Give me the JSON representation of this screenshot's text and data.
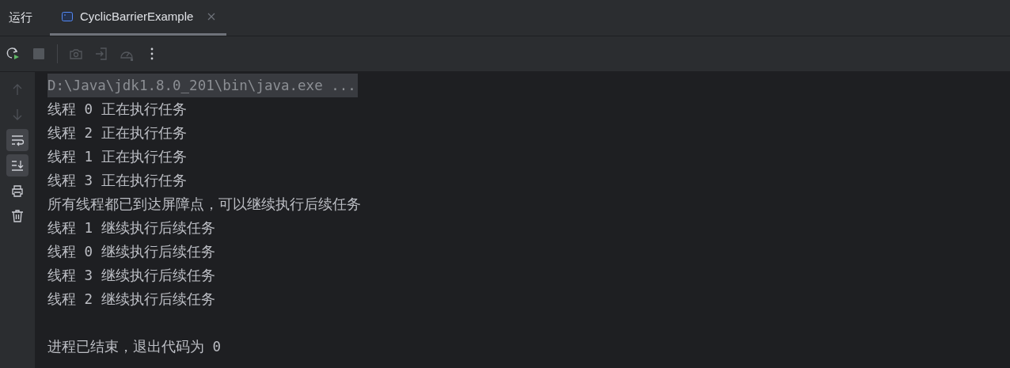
{
  "tool_window": {
    "title": "运行"
  },
  "tabs": [
    {
      "label": "CyclicBarrierExample",
      "selected": true
    }
  ],
  "toolbar": [
    {
      "kind": "rerun",
      "disabled": false
    },
    {
      "kind": "stop",
      "disabled": true
    },
    {
      "kind": "separator"
    },
    {
      "kind": "camera",
      "disabled": true
    },
    {
      "kind": "exit",
      "disabled": true
    },
    {
      "kind": "gauge",
      "disabled": true
    },
    {
      "kind": "more",
      "disabled": false
    }
  ],
  "gutter": [
    {
      "kind": "up",
      "on": false,
      "disabled": true
    },
    {
      "kind": "down",
      "on": false,
      "disabled": true
    },
    {
      "kind": "wrap",
      "on": true,
      "disabled": false
    },
    {
      "kind": "scroll",
      "on": true,
      "disabled": false
    },
    {
      "kind": "print",
      "on": false,
      "disabled": false
    },
    {
      "kind": "trash",
      "on": false,
      "disabled": false
    }
  ],
  "console": [
    {
      "kind": "command",
      "text": "D:\\Java\\jdk1.8.0_201\\bin\\java.exe ..."
    },
    {
      "kind": "output",
      "text": "线程 0 正在执行任务"
    },
    {
      "kind": "output",
      "text": "线程 2 正在执行任务"
    },
    {
      "kind": "output",
      "text": "线程 1 正在执行任务"
    },
    {
      "kind": "output",
      "text": "线程 3 正在执行任务"
    },
    {
      "kind": "output",
      "text": "所有线程都已到达屏障点，可以继续执行后续任务"
    },
    {
      "kind": "output",
      "text": "线程 1 继续执行后续任务"
    },
    {
      "kind": "output",
      "text": "线程 0 继续执行后续任务"
    },
    {
      "kind": "output",
      "text": "线程 3 继续执行后续任务"
    },
    {
      "kind": "output",
      "text": "线程 2 继续执行后续任务"
    },
    {
      "kind": "blank"
    },
    {
      "kind": "output",
      "text": "进程已结束，退出代码为 0"
    }
  ]
}
